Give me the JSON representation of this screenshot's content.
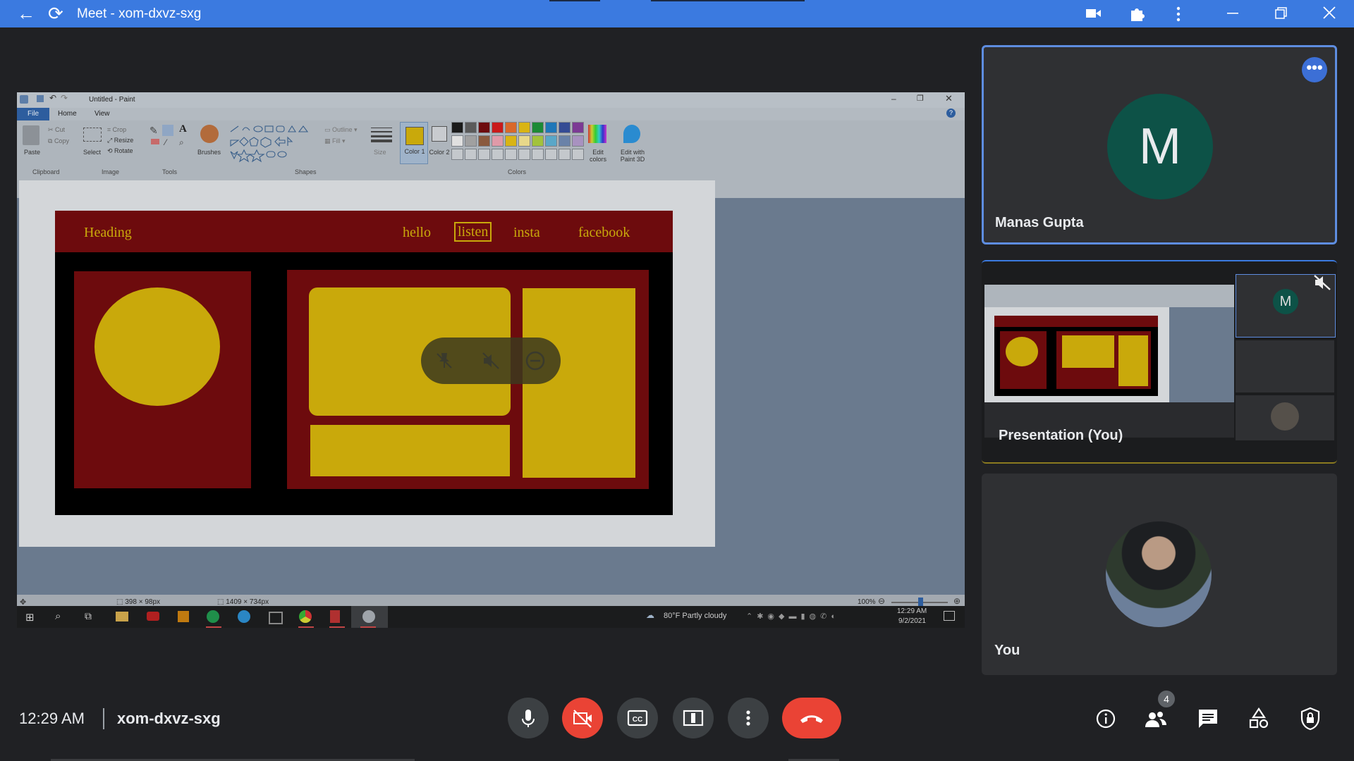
{
  "topbar": {
    "title": "Meet - xom-dxvz-sxg",
    "back_icon": "←",
    "reload_icon": "⟳"
  },
  "paint": {
    "window_title": "Untitled - Paint",
    "tabs": [
      "File",
      "Home",
      "View"
    ],
    "groups": {
      "clipboard": "Clipboard",
      "image": "Image",
      "tools": "Tools",
      "shapes": "Shapes",
      "colors": "Colors"
    },
    "tools": {
      "paste": "Paste",
      "cut": "Cut",
      "copy": "Copy",
      "select": "Select",
      "crop": "Crop",
      "resize": "Resize",
      "rotate": "Rotate",
      "brushes": "Brushes",
      "outline": "Outline",
      "fill": "Fill",
      "size": "Size",
      "color1": "Color 1",
      "color2": "Color 2",
      "edit_colors": "Edit colors",
      "edit_paint3d": "Edit with Paint 3D"
    },
    "palette_row1": [
      "#1a1a1a",
      "#5a5a5a",
      "#6d0b0d",
      "#c91a1a",
      "#d9682a",
      "#d9b414",
      "#1c8a35",
      "#1f77b8",
      "#344b94",
      "#7c3a94"
    ],
    "palette_row2": [
      "#e0e0e0",
      "#a0a0a0",
      "#8a5a3e",
      "#e09aa8",
      "#d9b414",
      "#e8d88a",
      "#a2c23c",
      "#5aa7c8",
      "#6a82a8",
      "#a892c0"
    ],
    "status": {
      "selection_size": "398 × 98px",
      "image_size": "1409 × 734px",
      "zoom": "100%"
    }
  },
  "drawing": {
    "heading": "Heading",
    "nav": [
      "hello",
      "listen",
      "insta",
      "facebook"
    ],
    "selected_nav": "listen"
  },
  "pin_overlay": {
    "pin_icon": "pin-off-icon",
    "mute_icon": "volume-off-icon",
    "remove_icon": "minus-circle-icon"
  },
  "taskbar": {
    "weather": "80°F  Partly cloudy",
    "time": "12:29 AM",
    "date": "9/2/2021"
  },
  "participants": {
    "manas": {
      "name": "Manas Gupta",
      "initial": "M"
    },
    "presentation": {
      "label": "Presentation (You)"
    },
    "you": {
      "name": "You"
    }
  },
  "bottombar": {
    "time": "12:29 AM",
    "meeting_code": "xom-dxvz-sxg",
    "people_count": "4"
  },
  "colors": {
    "accent_blue": "#3b7ae0",
    "end_call_red": "#ea4335",
    "manas_avatar": "#0d5247",
    "paint_maroon": "#6d0b0d",
    "paint_yellow": "#c9a90b"
  }
}
